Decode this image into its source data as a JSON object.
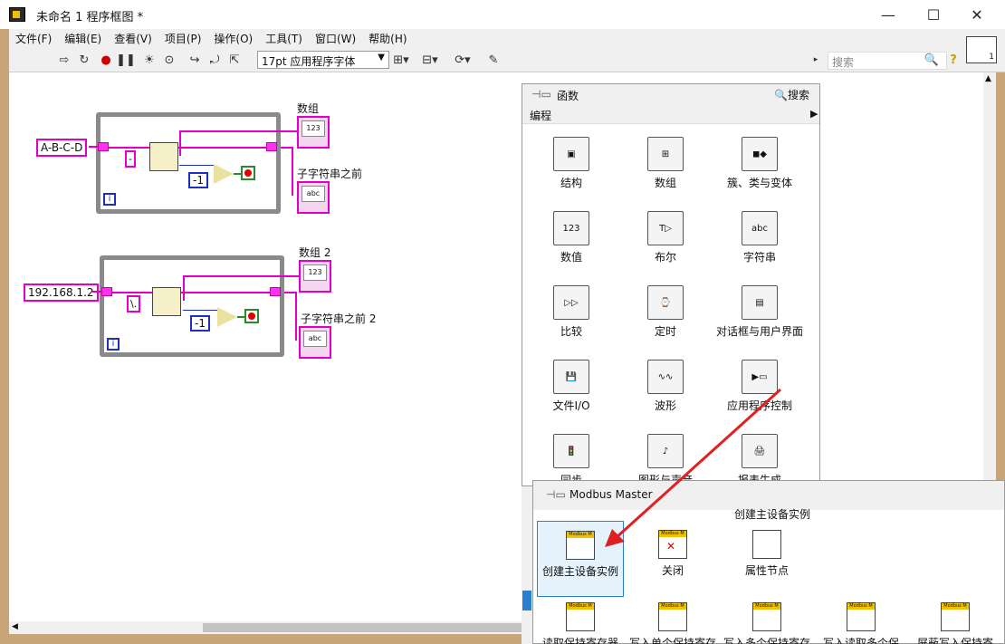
{
  "window": {
    "title": "未命名 1 程序框图 *",
    "minimize": "—",
    "maximize": "☐",
    "close": "✕"
  },
  "menu": [
    "文件(F)",
    "编辑(E)",
    "查看(V)",
    "项目(P)",
    "操作(O)",
    "工具(T)",
    "窗口(W)",
    "帮助(H)"
  ],
  "toolbar": {
    "font": "17pt 应用程序字体",
    "search_placeholder": "搜索",
    "help": "?",
    "vi_number": "1"
  },
  "diagram": {
    "loop1": {
      "input": "A-B-C-D",
      "separator": "-",
      "constant": "-1",
      "iter": "i",
      "array_label": "数组",
      "string_label": "子字符串之前"
    },
    "loop2": {
      "input": "192.168.1.2",
      "separator": "\\.",
      "constant": "-1",
      "iter": "i",
      "array_label": "数组 2",
      "string_label": "子字符串之前 2"
    },
    "indicator_text": "abc",
    "array_text": "123"
  },
  "palette": {
    "title": "函数",
    "search": "搜索",
    "category": "编程",
    "items": [
      {
        "label": "结构"
      },
      {
        "label": "数组"
      },
      {
        "label": "簇、类与变体"
      },
      {
        "label": "数值"
      },
      {
        "label": "布尔"
      },
      {
        "label": "字符串"
      },
      {
        "label": "比较"
      },
      {
        "label": "定时"
      },
      {
        "label": "对话框与用户界面"
      },
      {
        "label": "文件I/O"
      },
      {
        "label": "波形"
      },
      {
        "label": "应用程序控制"
      },
      {
        "label": "同步"
      },
      {
        "label": "图形与声音"
      },
      {
        "label": "报表生成"
      }
    ]
  },
  "modbus": {
    "title": "Modbus Master",
    "selected_name": "创建主设备实例",
    "band": "Modbus M",
    "items": [
      {
        "label": "创建主设备实例"
      },
      {
        "label": "关闭"
      },
      {
        "label": "属性节点"
      },
      {
        "label": "读取保持寄存器"
      },
      {
        "label": "写入单个保持寄存"
      },
      {
        "label": "写入多个保持寄存"
      },
      {
        "label": "写入读取多个保"
      },
      {
        "label": "屏蔽写入保持寄"
      }
    ]
  },
  "colors": {
    "string_wire": "#e000c8",
    "numeric_wire": "#1f2fc0",
    "boolean_wire": "#2c8a2c",
    "loop_border": "#8a8a8a",
    "arrow": "#e02020",
    "selection": "#2a7fd0"
  }
}
